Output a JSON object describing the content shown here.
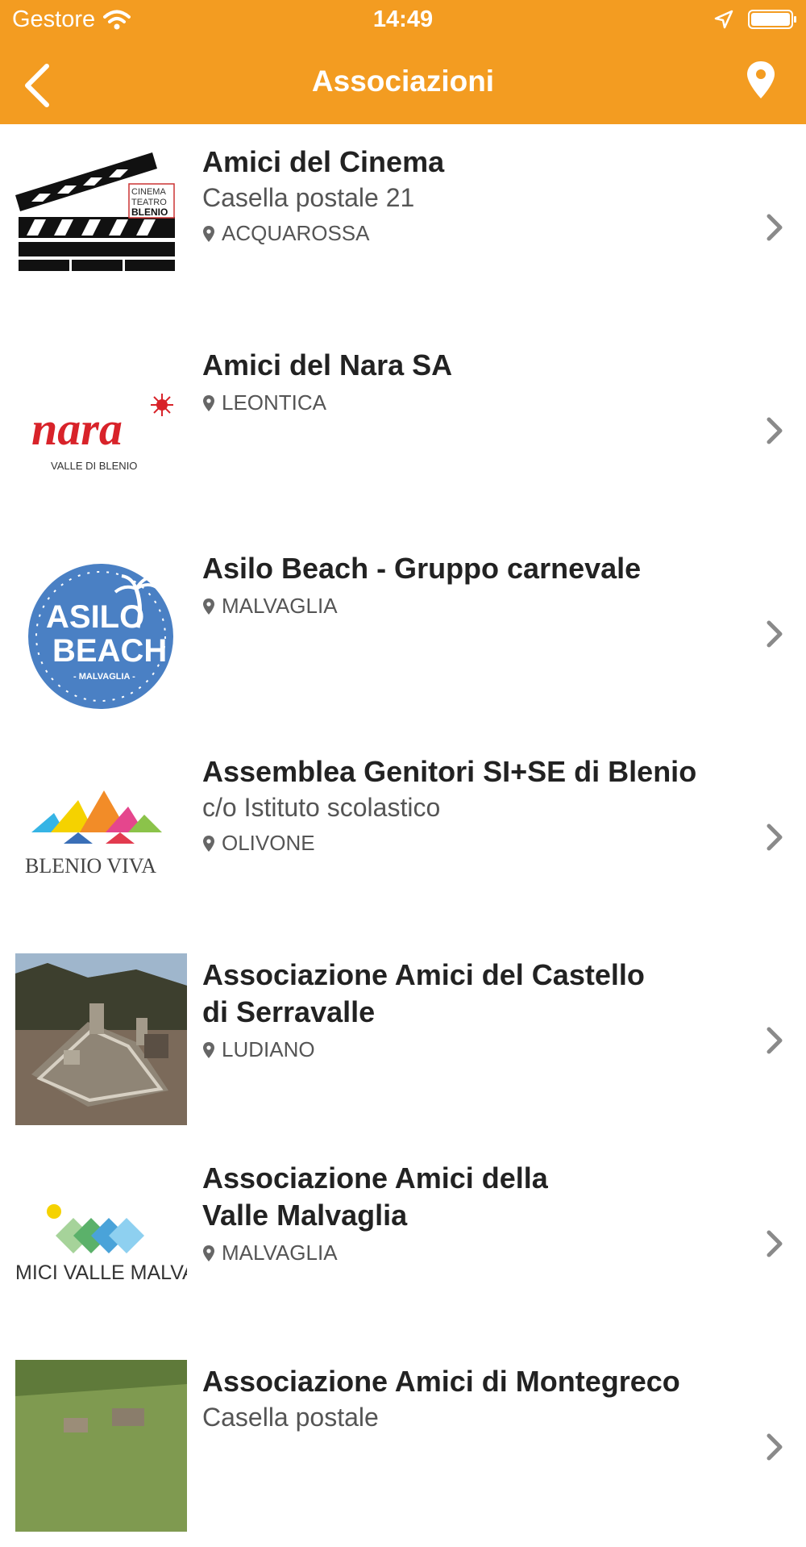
{
  "status_bar": {
    "carrier": "Gestore",
    "time": "14:49"
  },
  "nav": {
    "title": "Associazioni"
  },
  "items": [
    {
      "name": "Amici del Cinema",
      "sub": "Casella postale 21",
      "location": "ACQUAROSSA",
      "logo_text": [
        "CINEMA",
        "TEATRO",
        "BLENIO"
      ]
    },
    {
      "name": "Amici del Nara SA",
      "sub": "",
      "location": "LEONTICA",
      "logo_text": [
        "nara",
        "VALLE DI BLENIO"
      ]
    },
    {
      "name": "Asilo Beach - Gruppo carnevale",
      "sub": "",
      "location": "MALVAGLIA",
      "logo_text": [
        "ASILO",
        "BEACH",
        "- MALVAGLIA -"
      ]
    },
    {
      "name": "Assemblea Genitori SI+SE di Blenio",
      "sub": "c/o Istituto scolastico",
      "location": "OLIVONE",
      "logo_text": [
        "BLENIO VIVA"
      ]
    },
    {
      "name": "Associazione Amici del Castello\ndi Serravalle",
      "sub": "",
      "location": "LUDIANO",
      "logo_text": []
    },
    {
      "name": "Associazione Amici della\nValle Malvaglia",
      "sub": "",
      "location": "MALVAGLIA",
      "logo_text": [
        "MICI VALLE MALVAGL"
      ]
    },
    {
      "name": "Associazione Amici di Montegreco",
      "sub": "Casella postale",
      "location": "",
      "logo_text": []
    }
  ],
  "colors": {
    "header": "#F39C21",
    "chevron": "#8a8a8a"
  }
}
